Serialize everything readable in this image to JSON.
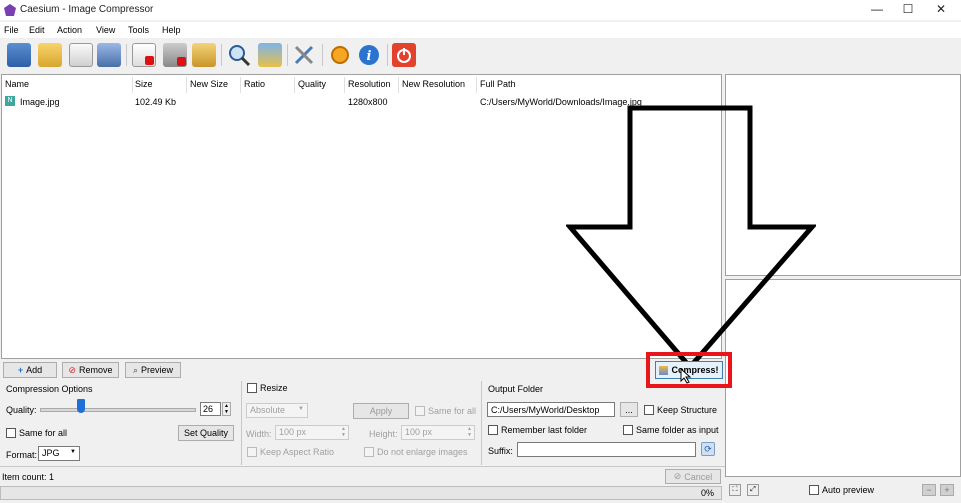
{
  "window": {
    "title": "Caesium - Image Compressor"
  },
  "menu": [
    "File",
    "Edit",
    "Action",
    "View",
    "Tools",
    "Help"
  ],
  "columns": [
    "Name",
    "Size",
    "New Size",
    "Ratio",
    "Quality",
    "Resolution",
    "New Resolution",
    "Full Path"
  ],
  "rows": [
    {
      "name": "Image.jpg",
      "size": "102.49 Kb",
      "new_size": "",
      "ratio": "",
      "quality": "",
      "resolution": "1280x800",
      "new_resolution": "",
      "path": "C:/Users/MyWorld/Downloads/Image.jpg"
    }
  ],
  "actions": {
    "add": "Add",
    "remove": "Remove",
    "preview": "Preview",
    "compress": "Compress!"
  },
  "compression": {
    "title": "Compression Options",
    "quality_label": "Quality:",
    "quality_value": "26",
    "slider_fraction": 0.26,
    "same_for_all": "Same for all",
    "set_quality": "Set Quality",
    "format_label": "Format:",
    "format_value": "JPG"
  },
  "resize": {
    "title": "Resize",
    "mode": "Absolute",
    "apply": "Apply",
    "same_for_all": "Same for all",
    "width_label": "Width:",
    "width_value": "100 px",
    "height_label": "Height:",
    "height_value": "100 px",
    "keep_aspect": "Keep Aspect Ratio",
    "no_enlarge": "Do not enlarge images"
  },
  "output": {
    "title": "Output Folder",
    "folder": "C:/Users/MyWorld/Desktop",
    "browse": "...",
    "keep_structure": "Keep Structure",
    "remember": "Remember last folder",
    "same_folder": "Same folder as input",
    "suffix_label": "Suffix:",
    "suffix_value": ""
  },
  "status": {
    "item_count": "Item count: 1",
    "cancel": "Cancel",
    "progress": "0%",
    "progress_fraction": 0
  },
  "preview_panel": {
    "auto_preview": "Auto preview"
  },
  "colors": {
    "highlight": "#e8151b",
    "arrow": "#000000",
    "accent": "#1f6fd6"
  }
}
